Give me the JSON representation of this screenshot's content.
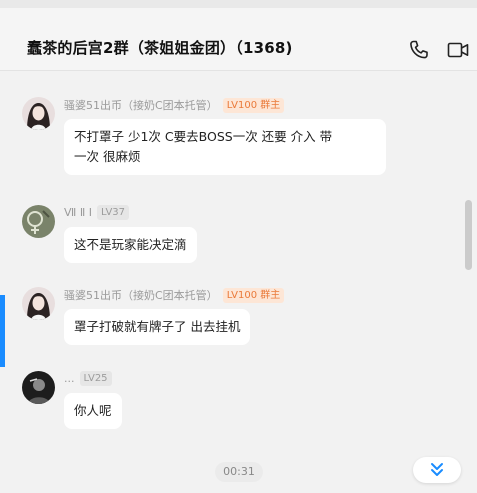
{
  "header": {
    "title": "蠢茶的后宫2群（茶姐姐金团）（1368)",
    "phone_icon": "phone-icon",
    "video_icon": "video-camera-icon"
  },
  "messages": [
    {
      "sender": "骚婆51出币（接奶C团本托管）",
      "badge": "LV100 群主",
      "text_lines": [
        "不打罩子 少1次  C要去BOSS一次  还要 介入 带",
        "一次  很麻烦"
      ]
    },
    {
      "sender": "Ⅶ Ⅱ Ⅰ",
      "badge": "LV37",
      "text_lines": [
        "这不是玩家能决定滴"
      ]
    },
    {
      "sender": "骚婆51出币（接奶C团本托管）",
      "badge": "LV100 群主",
      "text_lines": [
        "罩子打破就有牌子了 出去挂机"
      ]
    },
    {
      "sender": "...",
      "badge": "LV25",
      "text_lines": [
        "你人呢"
      ]
    }
  ],
  "footer": {
    "time": "00:31",
    "scroll_down_icon": "double-chevron-down-icon"
  },
  "colors": {
    "accent": "#1a8cff",
    "owner_badge_bg": "#fde6d6",
    "owner_badge_text": "#ea7a3a"
  }
}
